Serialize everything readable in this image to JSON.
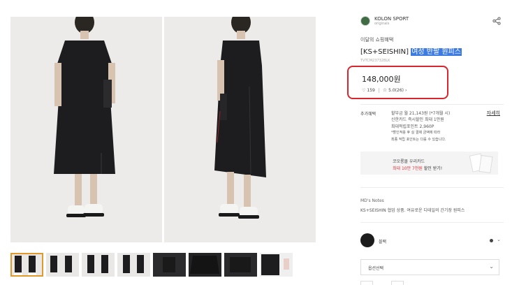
{
  "brand": {
    "name": "KOLON SPORT",
    "sub": "originals"
  },
  "product": {
    "promo": "이달의 쇼핑혜택",
    "title_prefix": "[KS+SEISHIN]",
    "title_highlight": "여성 반팔 원피스",
    "code": "TVTCM23732BLK",
    "price": "148,000원",
    "likes": "159",
    "rating": "5.0",
    "reviews": "(26)"
  },
  "benefit": {
    "label": "추가혜택",
    "detail_link": "자세히",
    "lines": [
      "할부금 월 21,143원 (*7개월 시)",
      "신한카드 즉시할인 최대 1만원",
      "최대적립포인트 2,960P",
      "*할인적용 후 실 결제 금액에 따라",
      "최종 적립 포인트는 다를 수 있습니다."
    ]
  },
  "card_banner": {
    "line1": "코오롱몰 우리카드",
    "line2_red": "최대 10만 7천원",
    "line2_rest": " 할인 받기!"
  },
  "notes": {
    "title": "MD's Notes",
    "text": "KS+SEISHIN 협업 상품. 여유로운 디테일의 간기장 원피스"
  },
  "color": {
    "name": "블랙",
    "swatch": "#1c1c1c"
  },
  "option_select": {
    "placeholder": "옵션선택"
  },
  "colors": {
    "highlight": "#3d7be0",
    "annotation": "#d8262f",
    "active_thumb": "#e09a2b",
    "red_text": "#e0323a"
  },
  "icons": [
    "share-icon",
    "heart-icon",
    "star-icon",
    "chevron-right-icon",
    "chevron-down-icon"
  ]
}
